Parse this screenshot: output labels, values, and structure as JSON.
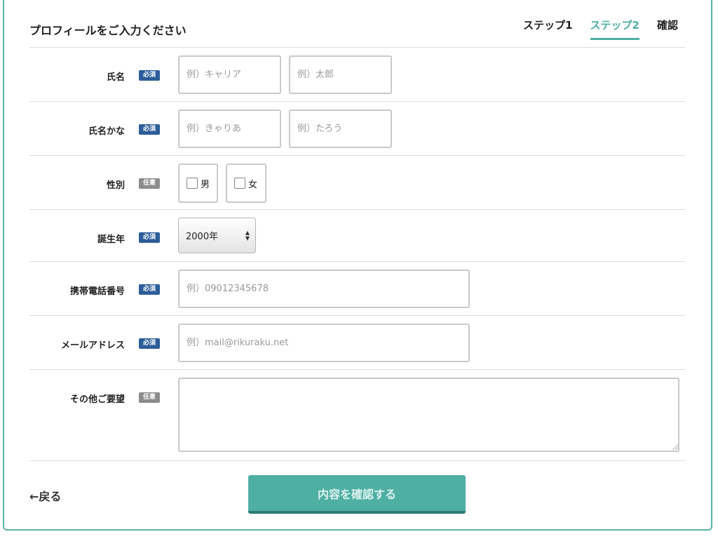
{
  "header": {
    "title": "プロフィールをご入力ください",
    "steps": [
      {
        "label": "ステップ1",
        "active": false
      },
      {
        "label": "ステップ2",
        "active": true
      },
      {
        "label": "確認",
        "active": false
      }
    ]
  },
  "badges": {
    "required": "必須",
    "optional": "任意"
  },
  "fields": {
    "name": {
      "label": "氏名",
      "placeholder_last": "例）キャリア",
      "placeholder_first": "例）太郎"
    },
    "kana": {
      "label": "氏名かな",
      "placeholder_last": "例）きゃりあ",
      "placeholder_first": "例）たろう"
    },
    "gender": {
      "label": "性別",
      "options": [
        "男",
        "女"
      ]
    },
    "birth_year": {
      "label": "誕生年",
      "value": "2000年"
    },
    "phone": {
      "label": "携帯電話番号",
      "placeholder": "例）09012345678"
    },
    "email": {
      "label": "メールアドレス",
      "placeholder": "例）mail@rikuraku.net"
    },
    "requests": {
      "label": "その他ご要望",
      "value": ""
    }
  },
  "footer": {
    "back_label": "←戻る",
    "submit_label": "内容を確認する"
  },
  "colors": {
    "accent": "#4eafa3",
    "required_badge": "#2c5d9a",
    "optional_badge": "#8c8c8c"
  }
}
